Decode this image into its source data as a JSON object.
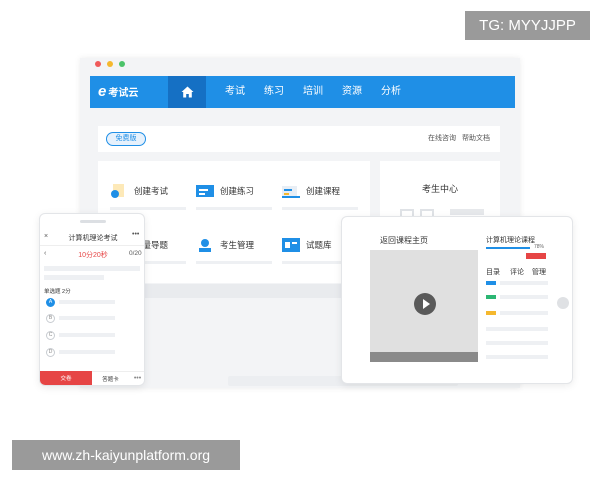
{
  "watermark_top": "TG: MYYJJPP",
  "watermark_bottom": "www.zh-kaiyunplatform.org",
  "window": {
    "dot_colors": [
      "#f05a5a",
      "#f5b82e",
      "#4cc36a"
    ],
    "accent": "#1f8fe6",
    "brand_letter": "e",
    "brand_name": "考试云",
    "nav": [
      "考试",
      "练习",
      "培训",
      "资源",
      "分析"
    ],
    "home_icon": "home-icon",
    "badge": "免费版",
    "links": [
      "在线咨询",
      "帮助文档"
    ],
    "tiles": [
      {
        "label": "创建考试",
        "icon": "exam-icon"
      },
      {
        "label": "创建练习",
        "icon": "practice-icon"
      },
      {
        "label": "创建课程",
        "icon": "course-icon"
      },
      {
        "label": "批量导题",
        "icon": "import-icon"
      },
      {
        "label": "考生管理",
        "icon": "user-manage-icon"
      },
      {
        "label": "试题库",
        "icon": "question-bank-icon"
      }
    ],
    "student_center": "考生中心"
  },
  "tablet": {
    "back": "返回课程主页",
    "course_title": "计算机理论课程",
    "progress_percent": 78,
    "progress_label": "78%",
    "tabs": [
      "目录",
      "评论",
      "管理"
    ],
    "marker_colors": [
      "#1f8fe6",
      "#2bb673",
      "#f5b82e"
    ]
  },
  "phone": {
    "close": "×",
    "title": "计算机理论考试",
    "more": "•••",
    "back": "‹",
    "timer": "10分20秒",
    "count": "0/20",
    "question_type": "单选题 2分",
    "options": [
      "A",
      "B",
      "C",
      "D"
    ],
    "selected_option": "A",
    "submit": "交卷",
    "next": "答题卡",
    "footer_more": "•••"
  }
}
